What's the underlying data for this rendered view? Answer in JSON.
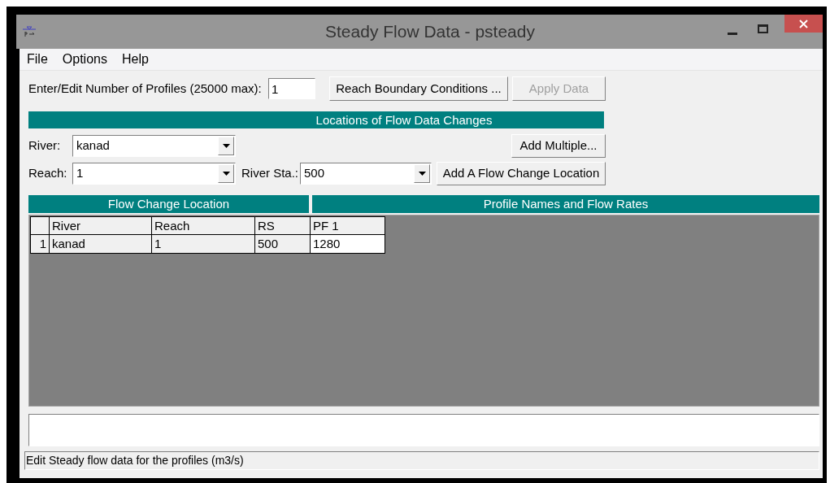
{
  "window": {
    "title": "Steady Flow Data - psteady"
  },
  "menu": [
    "File",
    "Options",
    "Help"
  ],
  "profiles": {
    "label": "Enter/Edit Number of Profiles (25000 max):",
    "value": "1"
  },
  "top_buttons": [
    {
      "label": "Reach Boundary Conditions ...",
      "disabled": false
    },
    {
      "label": "Apply Data",
      "disabled": true
    }
  ],
  "locations_header": "Locations of Flow Data Changes",
  "river": {
    "label": "River:",
    "value": "kanad"
  },
  "add_multiple": "Add Multiple...",
  "reach": {
    "label": "Reach:",
    "value": "1"
  },
  "river_sta": {
    "label": "River Sta.:",
    "value": "500"
  },
  "add_location": "Add A Flow Change Location",
  "left_header": "Flow Change Location",
  "right_header": "Profile Names and Flow Rates",
  "table": {
    "columns": [
      "River",
      "Reach",
      "RS",
      "PF 1"
    ],
    "rows": [
      {
        "index": "1",
        "cells": [
          "kanad",
          "1",
          "500",
          "1280"
        ]
      }
    ]
  },
  "status_bar": "Edit Steady flow data for the profiles (m3/s)"
}
